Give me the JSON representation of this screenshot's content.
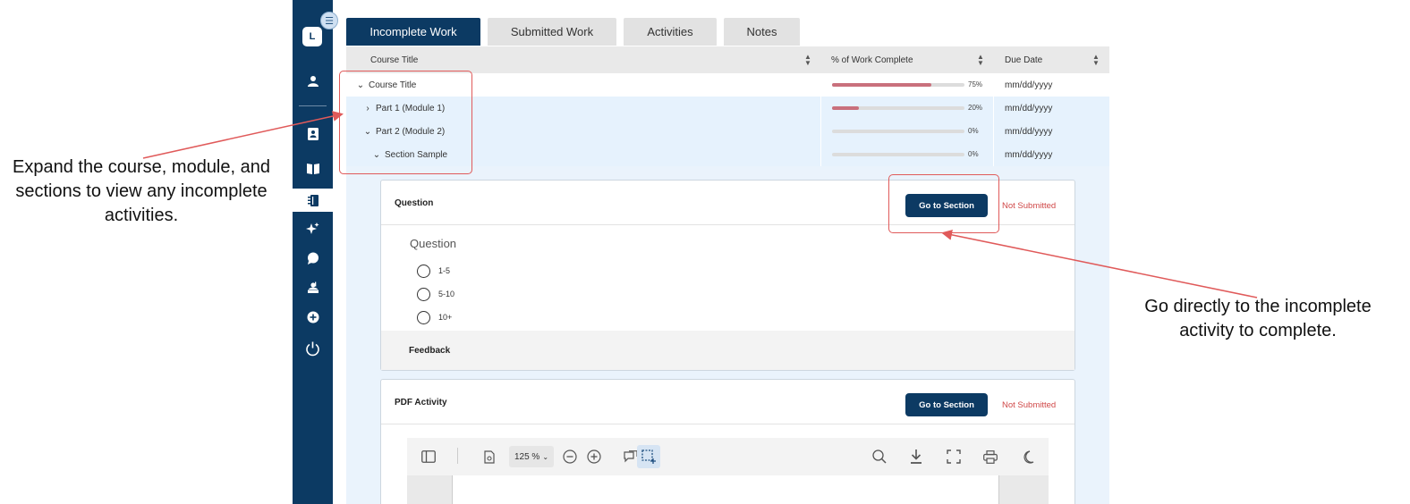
{
  "sidebar": {
    "logo_letter": "L",
    "icons": [
      "user-icon",
      "contact-card-icon",
      "book-icon",
      "notebook-icon",
      "sparkle-icon",
      "chat-bubble-icon",
      "teacher-icon",
      "add-circle-icon",
      "power-icon"
    ]
  },
  "tabs": [
    {
      "label": "Incomplete Work",
      "active": true
    },
    {
      "label": "Submitted Work",
      "active": false
    },
    {
      "label": "Activities",
      "active": false
    },
    {
      "label": "Notes",
      "active": false
    }
  ],
  "table": {
    "headers": {
      "course_title": "Course Title",
      "percent_complete": "% of Work Complete",
      "due_date": "Due Date"
    },
    "rows": [
      {
        "title": "Course Title",
        "expanded": true,
        "percent_label": "75%",
        "percent": 75,
        "due": "mm/dd/yyyy",
        "chevron": "⌄"
      },
      {
        "title": "Part 1 (Module 1)",
        "expanded": false,
        "percent_label": "20%",
        "percent": 20,
        "due": "mm/dd/yyyy",
        "chevron": "›"
      },
      {
        "title": "Part 2 (Module 2)",
        "expanded": true,
        "percent_label": "0%",
        "percent": 0,
        "due": "mm/dd/yyyy",
        "chevron": "⌄"
      },
      {
        "title": "Section Sample",
        "expanded": true,
        "percent_label": "0%",
        "percent": 0,
        "due": "mm/dd/yyyy",
        "chevron": "⌄"
      }
    ]
  },
  "cards": {
    "question": {
      "title": "Question",
      "button": "Go to Section",
      "status": "Not Submitted",
      "question_text": "Question",
      "options": [
        "1-5",
        "5-10",
        "10+"
      ],
      "feedback": "Feedback"
    },
    "pdf": {
      "title": "PDF Activity",
      "button": "Go to Section",
      "status": "Not Submitted",
      "zoom": "125 %"
    }
  },
  "annotations": {
    "left": "Expand the course, module, and sections to view any incomplete activities.",
    "right": "Go directly to the incomplete activity to complete."
  },
  "colors": {
    "navy": "#0c3a63",
    "highlight": "#e05a5a",
    "status": "#d04848",
    "progress": "#c9707c"
  }
}
